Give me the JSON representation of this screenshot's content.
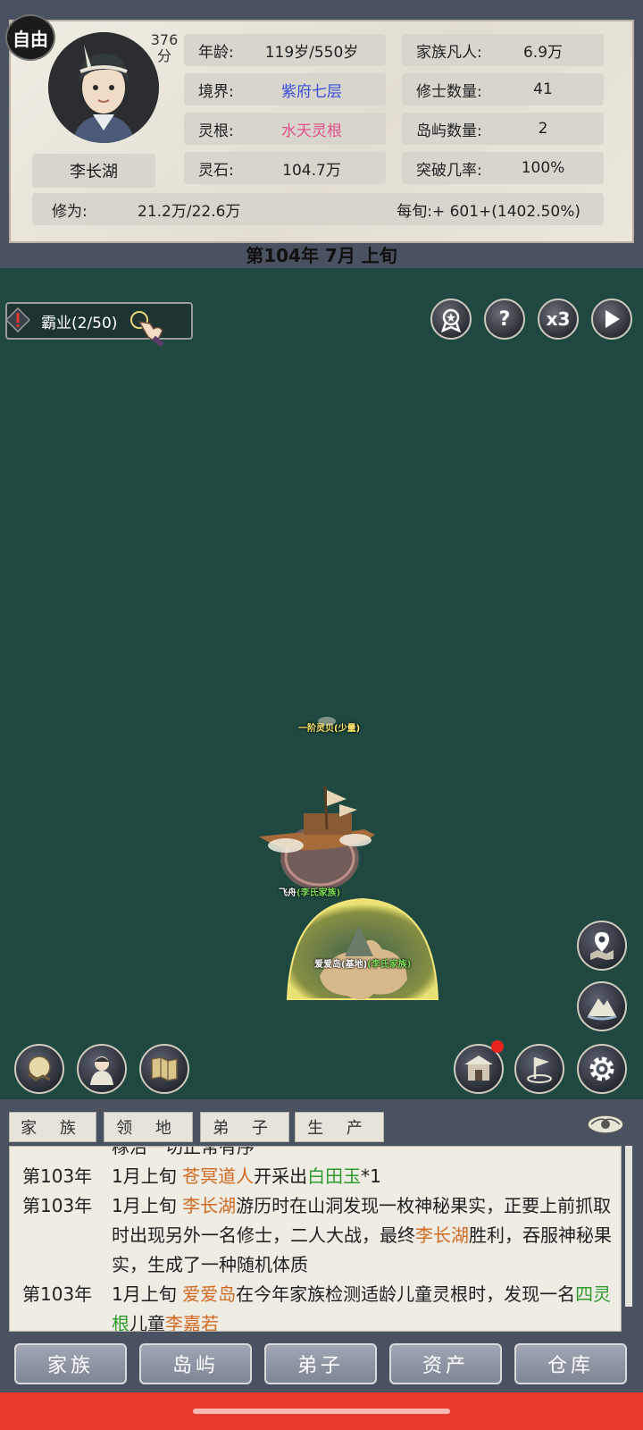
{
  "player": {
    "mode": "自由",
    "score": "376",
    "score_unit": "分",
    "name": "李长湖"
  },
  "stats": [
    {
      "label": "年龄:",
      "value": "119岁/550岁",
      "color": "#222222"
    },
    {
      "label": "家族凡人:",
      "value": "6.9万",
      "color": "#222222"
    },
    {
      "label": "境界:",
      "value": "紫府七层",
      "color": "#3a4fd8"
    },
    {
      "label": "修士数量:",
      "value": "41",
      "color": "#222222"
    },
    {
      "label": "灵根:",
      "value": "水天灵根",
      "color": "#e0508a"
    },
    {
      "label": "岛屿数量:",
      "value": "2",
      "color": "#222222"
    },
    {
      "label": "灵石:",
      "value": "104.7万",
      "color": "#222222"
    },
    {
      "label": "突破几率:",
      "value": "100%",
      "color": "#222222"
    }
  ],
  "cultivation": {
    "label": "修为:",
    "value": "21.2万/22.6万",
    "per_turn": "每旬:+ 601+(1402.50%)"
  },
  "date": "第104年 7月 上旬",
  "quest": {
    "label": "霸业(2/50)"
  },
  "top_buttons": {
    "speed": "x3"
  },
  "map": {
    "resource_label": "一阶灵贝(少量)",
    "ship_label": "飞舟",
    "ship_owner": "(李氏家族)",
    "island_label": "爱爱岛(基地)",
    "island_owner": "(李氏家族)"
  },
  "log_tabs": [
    "家 族",
    "领 地",
    "弟 子",
    "生 产"
  ],
  "log": {
    "partial_top": "稼治一切正常有序",
    "entries": [
      {
        "year": "第103年",
        "pre": "1月上旬 ",
        "actor": "苍冥道人",
        "mid": "开采出",
        "item": "白田玉",
        "post": "*1"
      },
      {
        "year": "第103年",
        "pre": "1月上旬 ",
        "actor": "李长湖",
        "mid": "游历时在山洞发现一枚神秘果实，正要上前抓取时出现另外一名修士，二人大战，最终",
        "actor2": "李长湖",
        "post": "胜利，吞服神秘果实，生成了一种随机体质"
      },
      {
        "year": "第103年",
        "pre": "1月上旬 ",
        "actor": "爱爱岛",
        "mid": "在今年家族检测适龄儿童灵根时，发现一名",
        "item": "四灵根",
        "post": "儿童",
        "actor2": "李嘉若"
      }
    ]
  },
  "nav": [
    "家族",
    "岛屿",
    "弟子",
    "资产",
    "仓库"
  ],
  "colors": {
    "map_bg": "#1f4840",
    "frame": "#4a5160",
    "system_bar": "#e63a2e"
  }
}
